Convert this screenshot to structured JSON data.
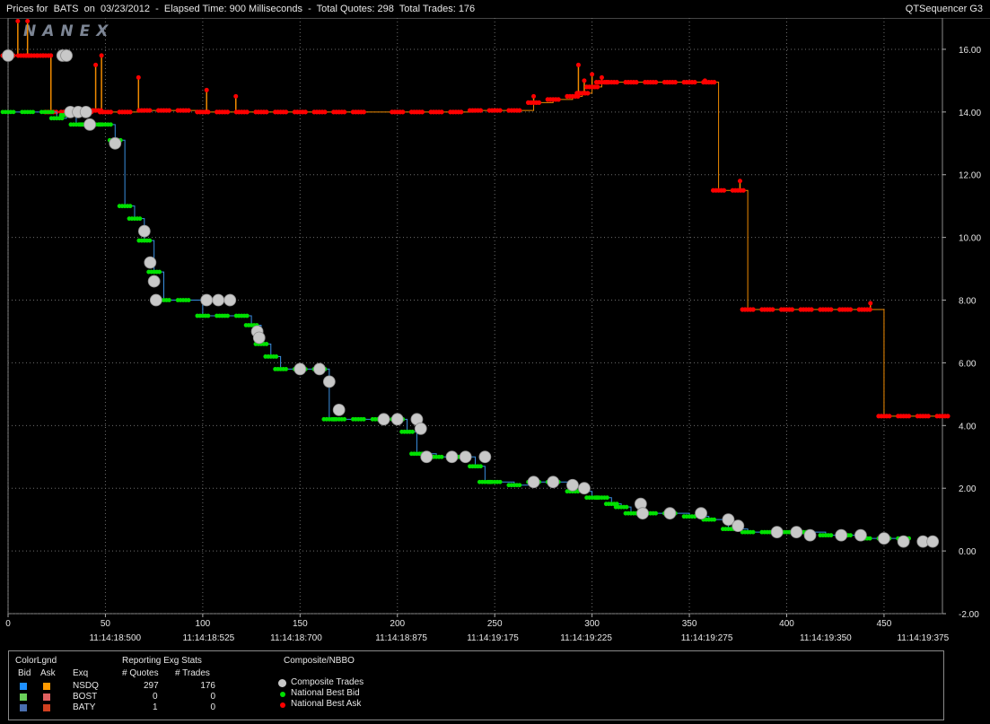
{
  "window": {
    "title": "Prices for  BATS  on  03/23/2012  -  Elapsed Time: 900 Milliseconds  -  Total Quotes: 298  Total Trades: 176",
    "app_name": "QTSequencer G3",
    "watermark": "NANEX"
  },
  "colors": {
    "background": "#000000",
    "grid": "#6e6e6e",
    "bid": "#00e000",
    "ask": "#ff0000",
    "bid_line": "#3a8fe0",
    "ask_line": "#f08a00",
    "trade": "#c8c8c8"
  },
  "chart_data": {
    "type": "scatter",
    "title": "Prices for  BATS  on  03/23/2012",
    "ylim": [
      -2,
      17
    ],
    "xlim": [
      0,
      480
    ],
    "y_ticks": [
      "16.00",
      "14.00",
      "12.00",
      "10.00",
      "8.00",
      "6.00",
      "4.00",
      "2.00",
      "0.00",
      "-2.00"
    ],
    "x_ticks": [
      "0",
      "50",
      "100",
      "150",
      "200",
      "250",
      "300",
      "350",
      "400",
      "450"
    ],
    "time_labels": [
      {
        "x": 55,
        "label": "11:14:18:500"
      },
      {
        "x": 103,
        "label": "11:14:18:525"
      },
      {
        "x": 148,
        "label": "11:14:18:700"
      },
      {
        "x": 202,
        "label": "11:14:18:875"
      },
      {
        "x": 249,
        "label": "11:14:19:175"
      },
      {
        "x": 297,
        "label": "11:14:19:225"
      },
      {
        "x": 359,
        "label": "11:14:19:275"
      },
      {
        "x": 420,
        "label": "11:14:19:350"
      },
      {
        "x": 470,
        "label": "11:14:19:375"
      }
    ],
    "grid": true,
    "series": [
      {
        "name": "National Best Ask",
        "kind": "ask",
        "points": [
          [
            0,
            15.8
          ],
          [
            8,
            15.8
          ],
          [
            12,
            15.8
          ],
          [
            18,
            15.8
          ],
          [
            22,
            14.0
          ],
          [
            30,
            14.0
          ],
          [
            40,
            14.0
          ],
          [
            45,
            14.05
          ],
          [
            50,
            14.0
          ],
          [
            60,
            14.0
          ],
          [
            70,
            14.05
          ],
          [
            80,
            14.05
          ],
          [
            90,
            14.05
          ],
          [
            100,
            14.0
          ],
          [
            110,
            14.0
          ],
          [
            120,
            14.0
          ],
          [
            130,
            14.0
          ],
          [
            140,
            14.0
          ],
          [
            150,
            14.0
          ],
          [
            160,
            14.0
          ],
          [
            170,
            14.0
          ],
          [
            180,
            14.0
          ],
          [
            200,
            14.0
          ],
          [
            210,
            14.0
          ],
          [
            220,
            14.0
          ],
          [
            230,
            14.0
          ],
          [
            240,
            14.05
          ],
          [
            250,
            14.05
          ],
          [
            260,
            14.05
          ],
          [
            270,
            14.3
          ],
          [
            280,
            14.4
          ],
          [
            290,
            14.5
          ],
          [
            295,
            14.6
          ],
          [
            300,
            14.8
          ],
          [
            305,
            14.95
          ],
          [
            310,
            14.95
          ],
          [
            320,
            14.95
          ],
          [
            330,
            14.95
          ],
          [
            340,
            14.95
          ],
          [
            350,
            14.95
          ],
          [
            360,
            14.95
          ],
          [
            365,
            11.5
          ],
          [
            375,
            11.5
          ],
          [
            380,
            7.7
          ],
          [
            390,
            7.7
          ],
          [
            400,
            7.7
          ],
          [
            410,
            7.7
          ],
          [
            420,
            7.7
          ],
          [
            430,
            7.7
          ],
          [
            440,
            7.7
          ],
          [
            450,
            4.3
          ],
          [
            460,
            4.3
          ],
          [
            470,
            4.3
          ],
          [
            480,
            4.3
          ]
        ],
        "spikes": [
          [
            5,
            16.9
          ],
          [
            10,
            16.9
          ],
          [
            18,
            15.8
          ],
          [
            22,
            15.8
          ],
          [
            45,
            15.5
          ],
          [
            48,
            15.8
          ],
          [
            67,
            15.1
          ],
          [
            102,
            14.7
          ],
          [
            117,
            14.5
          ],
          [
            270,
            14.5
          ],
          [
            293,
            15.5
          ],
          [
            296,
            15.0
          ],
          [
            300,
            15.2
          ],
          [
            305,
            15.1
          ],
          [
            358,
            15.0
          ],
          [
            376,
            11.8
          ],
          [
            443,
            7.9
          ]
        ]
      },
      {
        "name": "National Best Bid",
        "kind": "bid",
        "points": [
          [
            0,
            14.0
          ],
          [
            10,
            14.0
          ],
          [
            20,
            14.0
          ],
          [
            25,
            13.8
          ],
          [
            30,
            13.9
          ],
          [
            35,
            13.6
          ],
          [
            40,
            13.6
          ],
          [
            45,
            13.6
          ],
          [
            50,
            13.6
          ],
          [
            55,
            13.1
          ],
          [
            60,
            11.0
          ],
          [
            65,
            10.6
          ],
          [
            70,
            9.9
          ],
          [
            75,
            8.9
          ],
          [
            80,
            8.0
          ],
          [
            90,
            8.0
          ],
          [
            100,
            7.5
          ],
          [
            110,
            7.5
          ],
          [
            120,
            7.5
          ],
          [
            125,
            7.2
          ],
          [
            130,
            6.6
          ],
          [
            135,
            6.2
          ],
          [
            140,
            5.8
          ],
          [
            150,
            5.8
          ],
          [
            160,
            5.8
          ],
          [
            165,
            4.2
          ],
          [
            170,
            4.2
          ],
          [
            180,
            4.2
          ],
          [
            190,
            4.2
          ],
          [
            200,
            4.2
          ],
          [
            205,
            3.8
          ],
          [
            210,
            3.1
          ],
          [
            220,
            3.0
          ],
          [
            230,
            3.0
          ],
          [
            240,
            2.7
          ],
          [
            245,
            2.2
          ],
          [
            250,
            2.2
          ],
          [
            260,
            2.1
          ],
          [
            270,
            2.2
          ],
          [
            280,
            2.2
          ],
          [
            290,
            1.9
          ],
          [
            300,
            1.7
          ],
          [
            305,
            1.7
          ],
          [
            310,
            1.5
          ],
          [
            315,
            1.4
          ],
          [
            320,
            1.2
          ],
          [
            330,
            1.2
          ],
          [
            340,
            1.2
          ],
          [
            350,
            1.1
          ],
          [
            360,
            1.0
          ],
          [
            370,
            0.7
          ],
          [
            380,
            0.6
          ],
          [
            390,
            0.6
          ],
          [
            400,
            0.6
          ],
          [
            410,
            0.6
          ],
          [
            420,
            0.5
          ],
          [
            430,
            0.5
          ],
          [
            440,
            0.4
          ],
          [
            450,
            0.4
          ],
          [
            460,
            0.4
          ]
        ]
      },
      {
        "name": "Composite Trades",
        "kind": "trade",
        "points": [
          [
            0,
            15.8
          ],
          [
            28,
            15.8
          ],
          [
            30,
            15.8
          ],
          [
            32,
            14.0
          ],
          [
            36,
            14.0
          ],
          [
            40,
            14.0
          ],
          [
            42,
            13.6
          ],
          [
            55,
            13.0
          ],
          [
            70,
            10.2
          ],
          [
            73,
            9.2
          ],
          [
            75,
            8.6
          ],
          [
            76,
            8.0
          ],
          [
            102,
            8.0
          ],
          [
            108,
            8.0
          ],
          [
            114,
            8.0
          ],
          [
            128,
            7.0
          ],
          [
            129,
            6.8
          ],
          [
            150,
            5.8
          ],
          [
            160,
            5.8
          ],
          [
            165,
            5.4
          ],
          [
            170,
            4.5
          ],
          [
            193,
            4.2
          ],
          [
            200,
            4.2
          ],
          [
            210,
            4.2
          ],
          [
            212,
            3.9
          ],
          [
            215,
            3.0
          ],
          [
            228,
            3.0
          ],
          [
            235,
            3.0
          ],
          [
            245,
            3.0
          ],
          [
            270,
            2.2
          ],
          [
            280,
            2.2
          ],
          [
            290,
            2.1
          ],
          [
            296,
            2.0
          ],
          [
            325,
            1.5
          ],
          [
            326,
            1.2
          ],
          [
            340,
            1.2
          ],
          [
            356,
            1.2
          ],
          [
            370,
            1.0
          ],
          [
            375,
            0.8
          ],
          [
            395,
            0.6
          ],
          [
            405,
            0.6
          ],
          [
            412,
            0.5
          ],
          [
            428,
            0.5
          ],
          [
            438,
            0.5
          ],
          [
            450,
            0.4
          ],
          [
            460,
            0.3
          ],
          [
            470,
            0.3
          ],
          [
            475,
            0.3
          ]
        ]
      }
    ]
  },
  "legend": {
    "color_legend_title": "ColorLgnd",
    "bid_header": "Bid",
    "ask_header": "Ask",
    "exq_header": "Exq",
    "stats_title": "Reporting Exg Stats",
    "quotes_header": "# Quotes",
    "trades_header": "# Trades",
    "rows": [
      {
        "exchange": "NSDQ",
        "quotes": "297",
        "trades": "176",
        "bid_color": "#1e90ff",
        "ask_color": "#ff9a00"
      },
      {
        "exchange": "BOST",
        "quotes": "0",
        "trades": "0",
        "bid_color": "#6ad05a",
        "ask_color": "#e06060"
      },
      {
        "exchange": "BATY",
        "quotes": "1",
        "trades": "0",
        "bid_color": "#4a6fb0",
        "ask_color": "#d04020"
      }
    ],
    "composite_title": "Composite/NBBO",
    "composite_items": [
      {
        "label": "Composite Trades",
        "color": "#c8c8c8"
      },
      {
        "label": "National Best Bid",
        "color": "#00e000"
      },
      {
        "label": "National Best Ask",
        "color": "#ff0000"
      }
    ]
  }
}
